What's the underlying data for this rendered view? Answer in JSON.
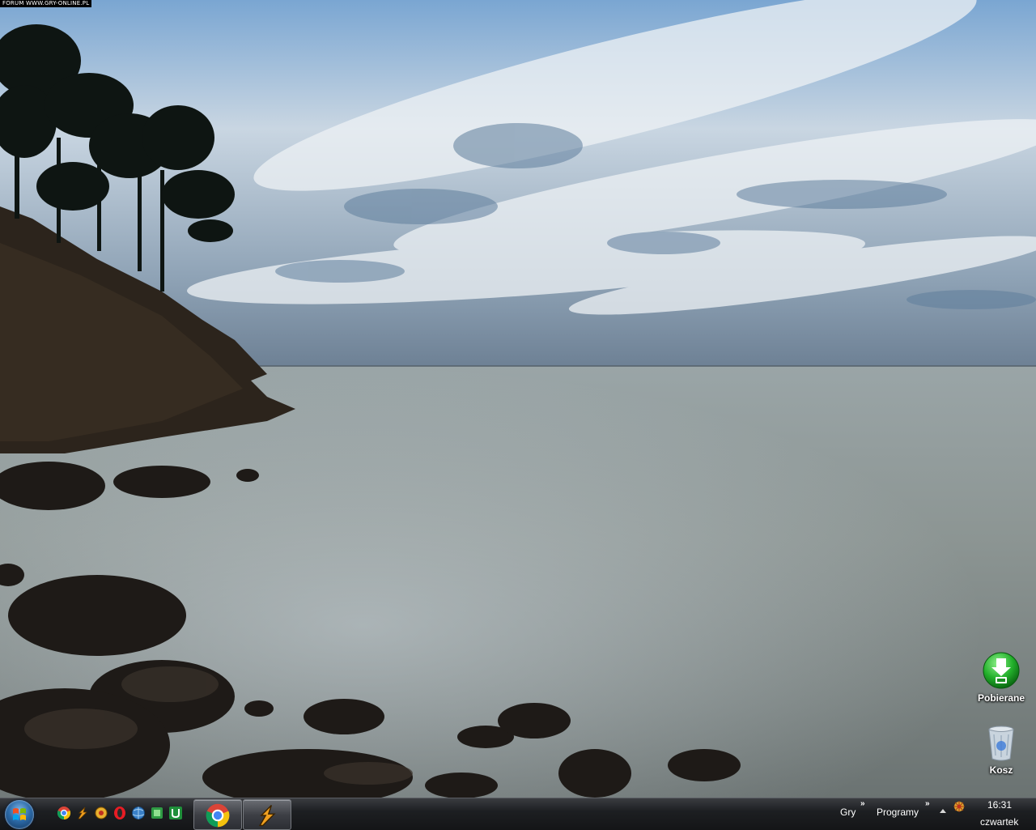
{
  "watermark": "FORUM WWW.GRY-ONLINE.PL",
  "wallpaper": {
    "description_colors": {
      "sky_top": "#6f9cc9",
      "cloud": "#e8edf1",
      "sea": "#8f9a98",
      "rock": "#2a231c"
    }
  },
  "desktop_icons": [
    {
      "label": "Pobierane",
      "icon": "download-folder-icon"
    },
    {
      "label": "Kosz",
      "icon": "recycle-bin-icon"
    }
  ],
  "taskbar": {
    "start_icon": "windows-start-orb",
    "quick_launch": [
      {
        "icon": "chrome-icon"
      },
      {
        "icon": "winamp-icon"
      },
      {
        "icon": "gadget-icon"
      },
      {
        "icon": "opera-icon"
      },
      {
        "icon": "globe-icon"
      },
      {
        "icon": "green-app-icon"
      },
      {
        "icon": "utorrent-icon"
      }
    ],
    "tasks": [
      {
        "icon": "chrome-icon"
      },
      {
        "icon": "winamp-icon"
      }
    ],
    "toolbars": {
      "gry": "Gry",
      "programy": "Programy",
      "chevron": "»"
    },
    "clock": {
      "time": "16:31",
      "day": "czwartek"
    }
  }
}
